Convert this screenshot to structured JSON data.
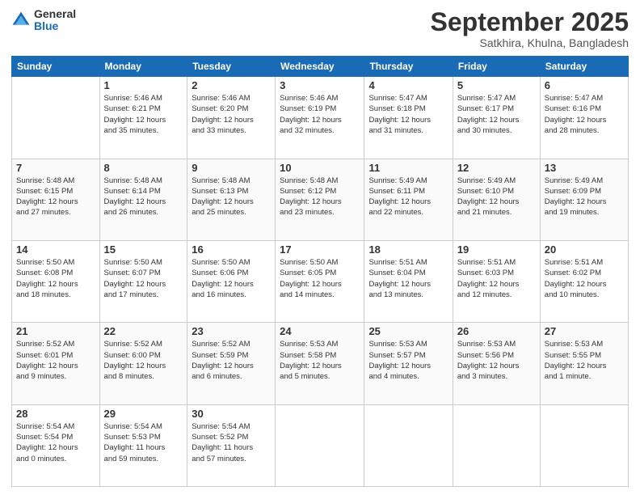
{
  "logo": {
    "general": "General",
    "blue": "Blue"
  },
  "header": {
    "month": "September 2025",
    "location": "Satkhira, Khulna, Bangladesh"
  },
  "weekdays": [
    "Sunday",
    "Monday",
    "Tuesday",
    "Wednesday",
    "Thursday",
    "Friday",
    "Saturday"
  ],
  "weeks": [
    [
      {
        "day": "",
        "info": ""
      },
      {
        "day": "1",
        "info": "Sunrise: 5:46 AM\nSunset: 6:21 PM\nDaylight: 12 hours\nand 35 minutes."
      },
      {
        "day": "2",
        "info": "Sunrise: 5:46 AM\nSunset: 6:20 PM\nDaylight: 12 hours\nand 33 minutes."
      },
      {
        "day": "3",
        "info": "Sunrise: 5:46 AM\nSunset: 6:19 PM\nDaylight: 12 hours\nand 32 minutes."
      },
      {
        "day": "4",
        "info": "Sunrise: 5:47 AM\nSunset: 6:18 PM\nDaylight: 12 hours\nand 31 minutes."
      },
      {
        "day": "5",
        "info": "Sunrise: 5:47 AM\nSunset: 6:17 PM\nDaylight: 12 hours\nand 30 minutes."
      },
      {
        "day": "6",
        "info": "Sunrise: 5:47 AM\nSunset: 6:16 PM\nDaylight: 12 hours\nand 28 minutes."
      }
    ],
    [
      {
        "day": "7",
        "info": "Sunrise: 5:48 AM\nSunset: 6:15 PM\nDaylight: 12 hours\nand 27 minutes."
      },
      {
        "day": "8",
        "info": "Sunrise: 5:48 AM\nSunset: 6:14 PM\nDaylight: 12 hours\nand 26 minutes."
      },
      {
        "day": "9",
        "info": "Sunrise: 5:48 AM\nSunset: 6:13 PM\nDaylight: 12 hours\nand 25 minutes."
      },
      {
        "day": "10",
        "info": "Sunrise: 5:48 AM\nSunset: 6:12 PM\nDaylight: 12 hours\nand 23 minutes."
      },
      {
        "day": "11",
        "info": "Sunrise: 5:49 AM\nSunset: 6:11 PM\nDaylight: 12 hours\nand 22 minutes."
      },
      {
        "day": "12",
        "info": "Sunrise: 5:49 AM\nSunset: 6:10 PM\nDaylight: 12 hours\nand 21 minutes."
      },
      {
        "day": "13",
        "info": "Sunrise: 5:49 AM\nSunset: 6:09 PM\nDaylight: 12 hours\nand 19 minutes."
      }
    ],
    [
      {
        "day": "14",
        "info": "Sunrise: 5:50 AM\nSunset: 6:08 PM\nDaylight: 12 hours\nand 18 minutes."
      },
      {
        "day": "15",
        "info": "Sunrise: 5:50 AM\nSunset: 6:07 PM\nDaylight: 12 hours\nand 17 minutes."
      },
      {
        "day": "16",
        "info": "Sunrise: 5:50 AM\nSunset: 6:06 PM\nDaylight: 12 hours\nand 16 minutes."
      },
      {
        "day": "17",
        "info": "Sunrise: 5:50 AM\nSunset: 6:05 PM\nDaylight: 12 hours\nand 14 minutes."
      },
      {
        "day": "18",
        "info": "Sunrise: 5:51 AM\nSunset: 6:04 PM\nDaylight: 12 hours\nand 13 minutes."
      },
      {
        "day": "19",
        "info": "Sunrise: 5:51 AM\nSunset: 6:03 PM\nDaylight: 12 hours\nand 12 minutes."
      },
      {
        "day": "20",
        "info": "Sunrise: 5:51 AM\nSunset: 6:02 PM\nDaylight: 12 hours\nand 10 minutes."
      }
    ],
    [
      {
        "day": "21",
        "info": "Sunrise: 5:52 AM\nSunset: 6:01 PM\nDaylight: 12 hours\nand 9 minutes."
      },
      {
        "day": "22",
        "info": "Sunrise: 5:52 AM\nSunset: 6:00 PM\nDaylight: 12 hours\nand 8 minutes."
      },
      {
        "day": "23",
        "info": "Sunrise: 5:52 AM\nSunset: 5:59 PM\nDaylight: 12 hours\nand 6 minutes."
      },
      {
        "day": "24",
        "info": "Sunrise: 5:53 AM\nSunset: 5:58 PM\nDaylight: 12 hours\nand 5 minutes."
      },
      {
        "day": "25",
        "info": "Sunrise: 5:53 AM\nSunset: 5:57 PM\nDaylight: 12 hours\nand 4 minutes."
      },
      {
        "day": "26",
        "info": "Sunrise: 5:53 AM\nSunset: 5:56 PM\nDaylight: 12 hours\nand 3 minutes."
      },
      {
        "day": "27",
        "info": "Sunrise: 5:53 AM\nSunset: 5:55 PM\nDaylight: 12 hours\nand 1 minute."
      }
    ],
    [
      {
        "day": "28",
        "info": "Sunrise: 5:54 AM\nSunset: 5:54 PM\nDaylight: 12 hours\nand 0 minutes."
      },
      {
        "day": "29",
        "info": "Sunrise: 5:54 AM\nSunset: 5:53 PM\nDaylight: 11 hours\nand 59 minutes."
      },
      {
        "day": "30",
        "info": "Sunrise: 5:54 AM\nSunset: 5:52 PM\nDaylight: 11 hours\nand 57 minutes."
      },
      {
        "day": "",
        "info": ""
      },
      {
        "day": "",
        "info": ""
      },
      {
        "day": "",
        "info": ""
      },
      {
        "day": "",
        "info": ""
      }
    ]
  ]
}
